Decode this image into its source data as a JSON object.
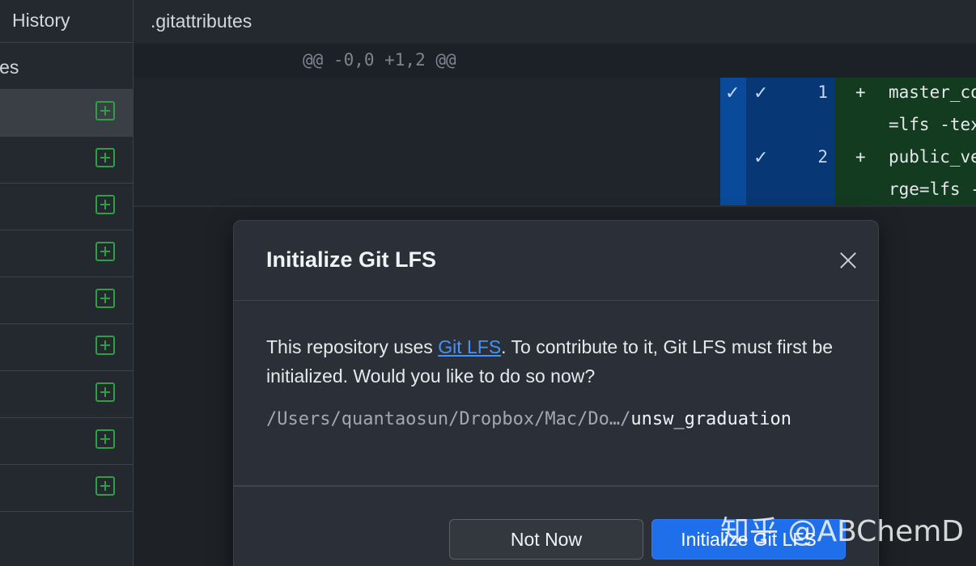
{
  "sidebar": {
    "tab_history": "History",
    "changes_label": "les",
    "file_rows": [
      {
        "selected": true,
        "icon": "add-icon"
      },
      {
        "selected": false,
        "icon": "add-icon"
      },
      {
        "selected": false,
        "icon": "add-icon"
      },
      {
        "selected": false,
        "icon": "add-icon"
      },
      {
        "selected": false,
        "icon": "add-icon"
      },
      {
        "selected": false,
        "icon": "add-icon"
      },
      {
        "selected": false,
        "icon": "add-icon"
      },
      {
        "selected": false,
        "icon": "add-icon"
      },
      {
        "selected": false,
        "icon": "add-icon"
      }
    ]
  },
  "diff": {
    "filename": ".gitattributes",
    "hunk_header": "@@ -0,0 +1,2 @@",
    "lines": [
      {
        "check_a": "✓",
        "check_b": "✓",
        "number": "1",
        "marker": "+",
        "text": "master_co",
        "wrap": "=lfs -tex"
      },
      {
        "check_a": "",
        "check_b": "✓",
        "number": "2",
        "marker": "+",
        "text": "public_ve",
        "wrap": "rge=lfs -"
      }
    ]
  },
  "modal": {
    "title": "Initialize Git LFS",
    "body_before_link": "This repository uses ",
    "link_text": "Git LFS",
    "body_after_link": ". To contribute to it, Git LFS must first be initialized. Would you like to do so now?",
    "path_prefix": "/Users/quantaosun/Dropbox/Mac/Do…/",
    "path_name": "unsw_graduation",
    "buttons": {
      "secondary": "Not Now",
      "primary": "Initialize Git LFS"
    }
  },
  "watermark": "知乎 @ABChemD",
  "colors": {
    "accent": "#1f6feb",
    "link": "#4493f8",
    "added": "#2ea043"
  }
}
